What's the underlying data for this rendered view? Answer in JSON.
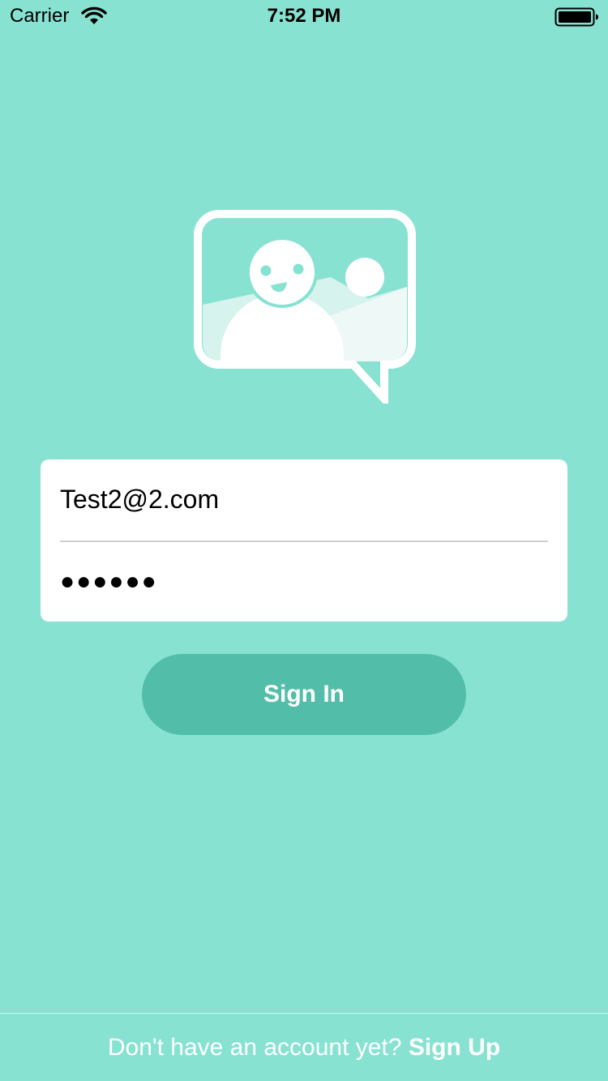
{
  "status_bar": {
    "carrier": "Carrier",
    "time": "7:52 PM",
    "icons": [
      "wifi-icon",
      "battery-icon"
    ]
  },
  "logo": {
    "icon": "photo-chat-bubble-icon"
  },
  "form": {
    "email_value": "Test2@2.com",
    "password_value": "●●●●●●"
  },
  "sign_in_label": "Sign In",
  "footer": {
    "prompt": "Don't have an account yet?",
    "sign_up_label": "Sign Up"
  },
  "colors": {
    "background": "#87E2D1",
    "button": "#52BEAA",
    "card": "#FFFFFF",
    "text_light": "#FFFFFF"
  }
}
